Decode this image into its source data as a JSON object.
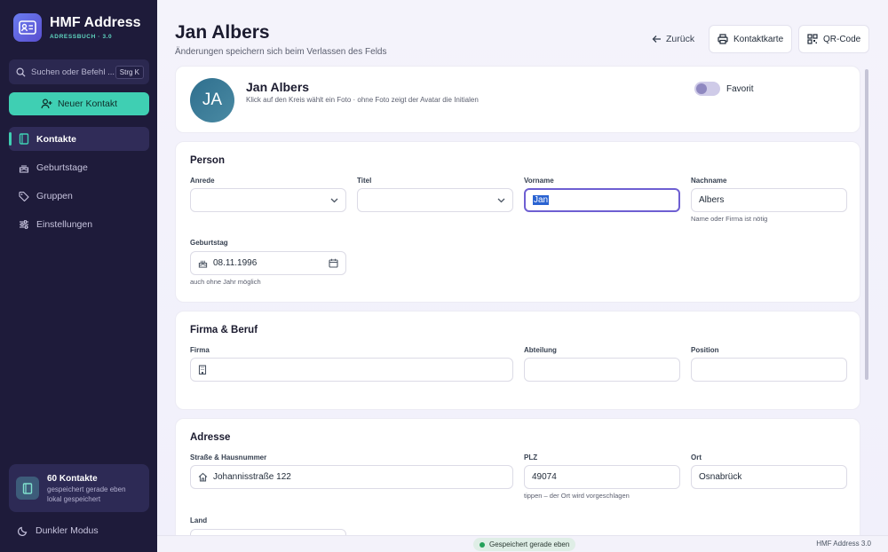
{
  "app": {
    "name": "HMF Address",
    "subtitle": "ADRESSBUCH · 3.0"
  },
  "sidebar": {
    "search_placeholder": "Suchen oder Befehl ...",
    "search_shortcut": "Strg K",
    "new_contact_label": "Neuer Kontakt",
    "items": [
      {
        "label": "Kontakte",
        "icon": "book-icon",
        "active": true
      },
      {
        "label": "Geburtstage",
        "icon": "cake-icon",
        "active": false
      },
      {
        "label": "Gruppen",
        "icon": "tag-icon",
        "active": false
      },
      {
        "label": "Einstellungen",
        "icon": "sliders-icon",
        "active": false
      }
    ],
    "stats": {
      "count": "60 Kontakte",
      "line1": "gespeichert gerade eben",
      "line2": "lokal gespeichert"
    },
    "dark_mode_label": "Dunkler Modus"
  },
  "header": {
    "title": "Jan Albers",
    "subtitle": "Änderungen speichern sich beim Verlassen des Felds",
    "back_label": "Zurück",
    "print_label": "Kontaktkarte",
    "qr_label": "QR-Code"
  },
  "profile": {
    "initials": "JA",
    "name": "Jan Albers",
    "hint": "Klick auf den Kreis wählt ein Foto · ohne Foto zeigt der Avatar die Initialen",
    "favorite_label": "Favorit",
    "favorite": false
  },
  "person": {
    "title": "Person",
    "anrede_label": "Anrede",
    "anrede_value": "",
    "titel_label": "Titel",
    "titel_value": "",
    "vorname_label": "Vorname",
    "vorname_value": "Jan",
    "nachname_label": "Nachname",
    "nachname_value": "Albers",
    "nachname_hint": "Name oder Firma ist nötig",
    "geburtstag_label": "Geburtstag",
    "geburtstag_value": "08.11.1996",
    "geburtstag_hint": "auch ohne Jahr möglich"
  },
  "firma": {
    "title": "Firma & Beruf",
    "firma_label": "Firma",
    "firma_value": "",
    "abteilung_label": "Abteilung",
    "abteilung_value": "",
    "position_label": "Position",
    "position_value": ""
  },
  "adresse": {
    "title": "Adresse",
    "strasse_label": "Straße & Hausnummer",
    "strasse_value": "Johannisstraße 122",
    "plz_label": "PLZ",
    "plz_value": "49074",
    "plz_hint": "tippen – der Ort wird vorgeschlagen",
    "ort_label": "Ort",
    "ort_value": "Osnabrück",
    "land_label": "Land"
  },
  "status": {
    "saved": "Gespeichert gerade eben",
    "version": "HMF Address 3.0"
  },
  "colors": {
    "accent": "#3fcfb3",
    "sidebar": "#1e1b3a",
    "focus": "#6e5fd2"
  }
}
